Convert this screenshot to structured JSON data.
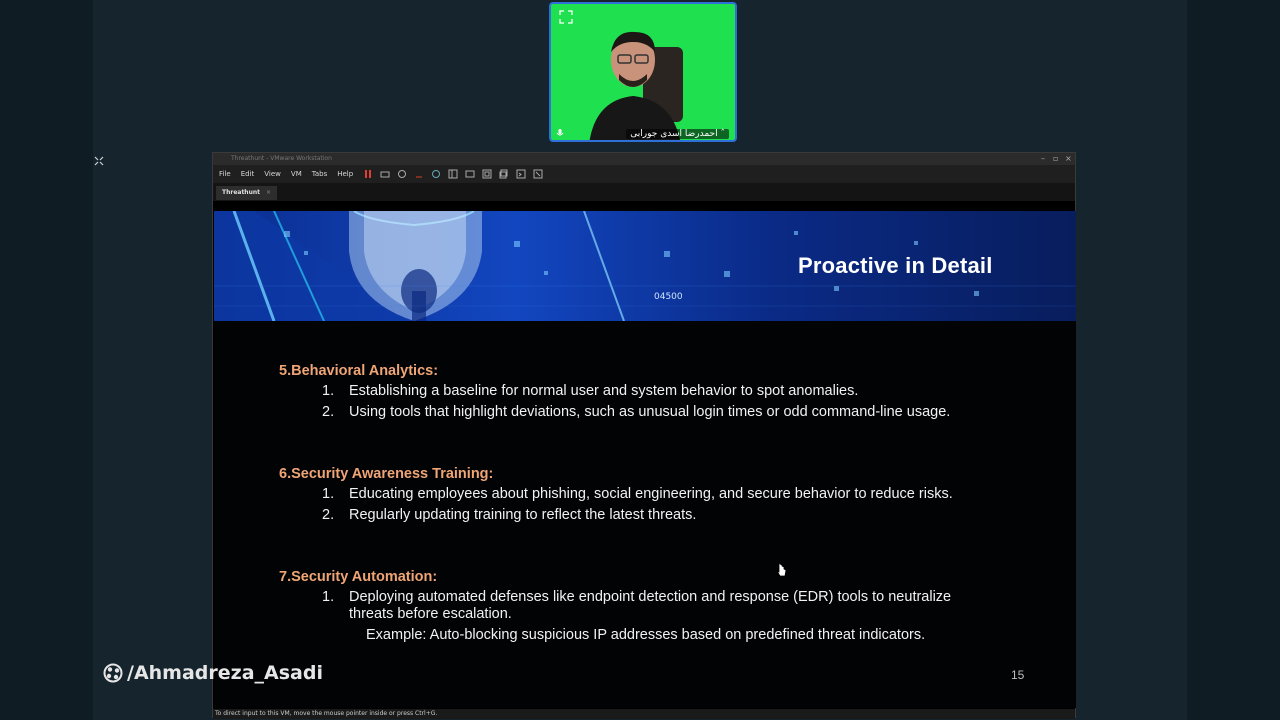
{
  "webcam": {
    "name": "احمدرضا اسدی جورابی ˆ",
    "expand_icon": "expand-icon",
    "mic_icon": "mic-icon"
  },
  "vm": {
    "title": "Threathunt - VMware Workstation",
    "menu": [
      "File",
      "Edit",
      "View",
      "VM",
      "Tabs",
      "Help"
    ],
    "tab_label": "Threathunt",
    "status": "To direct input to this VM, move the mouse pointer inside or press Ctrl+G."
  },
  "slide": {
    "title": "Proactive  in Detail",
    "page_number": "15",
    "sections": [
      {
        "heading": "5.Behavioral Analytics:",
        "items": [
          {
            "num": "1.",
            "text": "Establishing a baseline for normal user and system behavior to spot anomalies."
          },
          {
            "num": "2.",
            "text": "Using tools that highlight deviations, such as unusual login times or odd command-line usage."
          }
        ]
      },
      {
        "heading": "6.Security Awareness Training:",
        "items": [
          {
            "num": "1.",
            "text": "Educating employees about phishing, social engineering, and secure behavior to reduce risks."
          },
          {
            "num": "2.",
            "text": "Regularly updating training to reflect the latest threats."
          }
        ]
      },
      {
        "heading": "7.Security Automation:",
        "items": [
          {
            "num": "1.",
            "text": "Deploying automated defenses like endpoint detection and response (EDR) tools to neutralize threats before escalation."
          }
        ],
        "example": "Example: Auto-blocking suspicious IP addresses based on predefined threat indicators."
      }
    ],
    "banner_number": "04500"
  },
  "watermark": {
    "text": "/Ahmadreza_Asadi",
    "icon": "aparat-logo-icon"
  },
  "colors": {
    "heading": "#f0a576",
    "webcam_bg": "#1fe04f",
    "webcam_border": "#2f6fd8"
  }
}
